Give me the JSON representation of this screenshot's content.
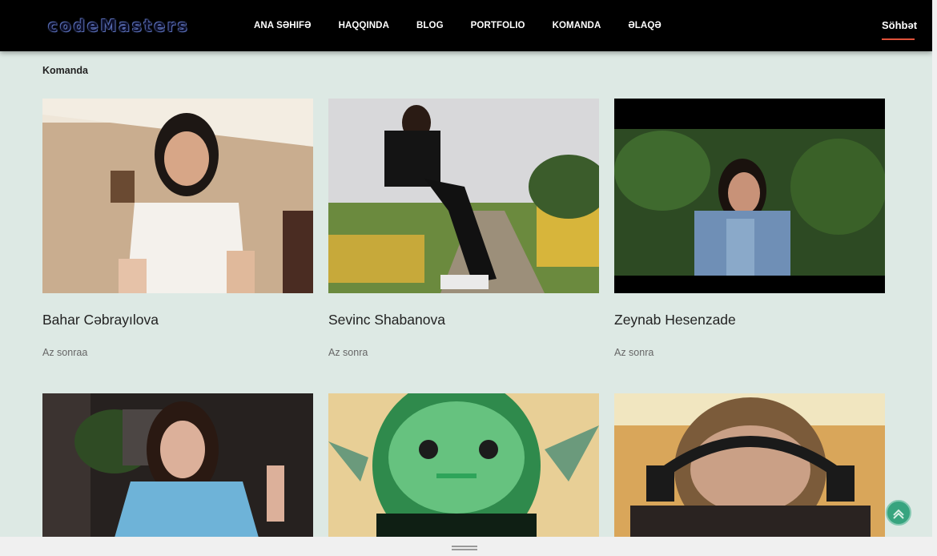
{
  "header": {
    "logo_text": "codeMasters",
    "nav": [
      "ANA SƏHIFƏ",
      "HAQQINDA",
      "BLOG",
      "PORTFOLIO",
      "KOMANDA",
      "ƏLAQƏ"
    ],
    "chat": "Söhbət"
  },
  "section": {
    "title": "Komanda"
  },
  "team": [
    {
      "name": "Bahar Cəbrayılova",
      "meta": "Az sonraa"
    },
    {
      "name": "Sevinc Shabanova",
      "meta": "Az sonra"
    },
    {
      "name": "Zeynab Hesenzade",
      "meta": "Az sonra"
    },
    {
      "name": "",
      "meta": ""
    },
    {
      "name": "",
      "meta": ""
    },
    {
      "name": "",
      "meta": ""
    }
  ],
  "colors": {
    "accent": "#e0523a",
    "to_top": "#37a47f",
    "page_bg": "#dde9e4"
  },
  "icons": {
    "to_top": "chevron-up-icon"
  }
}
